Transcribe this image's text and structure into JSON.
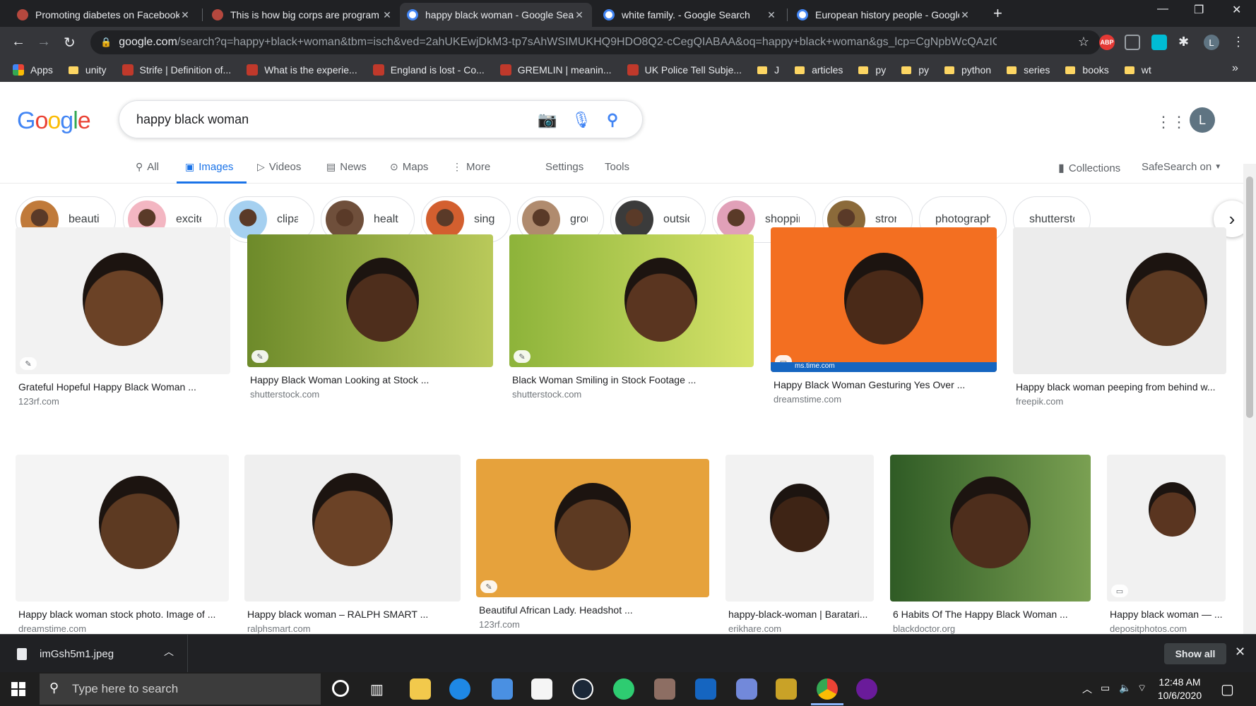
{
  "browser": {
    "tabs": [
      {
        "title": "Promoting diabetes on Facebook",
        "active": false
      },
      {
        "title": "This is how big corps are program",
        "active": false
      },
      {
        "title": "happy black woman - Google Sea",
        "active": true
      },
      {
        "title": "white family. - Google Search",
        "active": false
      },
      {
        "title": "European history people - Google",
        "active": false
      }
    ],
    "url_host": "google.com",
    "url_path": "/search?q=happy+black+woman&tbm=isch&ved=2ahUKEwjDkM3-tp7sAhWSIMUKHQ9HDO8Q2-cCegQIABAA&oq=happy+black+woman&gs_lcp=CgNpbWcQAzICCAAyA...",
    "profile_initial": "L",
    "abp_label": "ABP",
    "bookmarks": [
      {
        "label": "Apps",
        "kind": "apps"
      },
      {
        "label": "unity",
        "kind": "folder"
      },
      {
        "label": "Strife | Definition of...",
        "kind": "site"
      },
      {
        "label": "What is the experie...",
        "kind": "site"
      },
      {
        "label": "England is lost - Co...",
        "kind": "site"
      },
      {
        "label": "GREMLIN | meanin...",
        "kind": "site"
      },
      {
        "label": "UK Police Tell Subje...",
        "kind": "site"
      },
      {
        "label": "J",
        "kind": "folder"
      },
      {
        "label": "articles",
        "kind": "folder"
      },
      {
        "label": "py",
        "kind": "folder"
      },
      {
        "label": "py",
        "kind": "folder"
      },
      {
        "label": "python",
        "kind": "folder"
      },
      {
        "label": "series",
        "kind": "folder"
      },
      {
        "label": "books",
        "kind": "folder"
      },
      {
        "label": "wt",
        "kind": "folder"
      }
    ],
    "overflow": "»"
  },
  "google": {
    "logo": [
      "G",
      "o",
      "o",
      "g",
      "l",
      "e"
    ],
    "query": "happy black woman",
    "avatar": "L",
    "nav": {
      "all": "All",
      "images": "Images",
      "videos": "Videos",
      "news": "News",
      "maps": "Maps",
      "more": "More",
      "settings": "Settings",
      "tools": "Tools",
      "collections": "Collections",
      "safesearch": "SafeSearch on"
    },
    "chips": [
      "beautiful",
      "excited",
      "clipart",
      "healthy",
      "single",
      "group",
      "outside",
      "shopping",
      "strong",
      "photography",
      "shutterstc"
    ],
    "results_row1": [
      {
        "caption": "Grateful Hopeful Happy Black Woman ...",
        "source": "123rf.com",
        "tag": "✎"
      },
      {
        "caption": "Happy Black Woman Looking at Stock ...",
        "source": "shutterstock.com",
        "tag": "✎"
      },
      {
        "caption": "Black Woman Smiling in Stock Footage ...",
        "source": "shutterstock.com",
        "tag": "✎"
      },
      {
        "caption": "Happy Black Woman Gesturing Yes Over ...",
        "source": "dreamstime.com",
        "tag": "▭",
        "watermark": "ms.time.com"
      },
      {
        "caption": "Happy black woman peeping from behind w...",
        "source": "freepik.com",
        "tag": ""
      }
    ],
    "results_row2": [
      {
        "caption": "Happy black woman stock photo. Image of ...",
        "source": "dreamstime.com",
        "tag": ""
      },
      {
        "caption": "Happy black woman – RALPH SMART ...",
        "source": "ralphsmart.com",
        "tag": ""
      },
      {
        "caption": "Beautiful African Lady. Headshot ...",
        "source": "123rf.com",
        "tag": "✎"
      },
      {
        "caption": "happy-black-woman | Baratari...",
        "source": "erikhare.com",
        "tag": ""
      },
      {
        "caption": "6 Habits Of The Happy Black Woman ...",
        "source": "blackdoctor.org",
        "tag": ""
      },
      {
        "caption": "Happy black woman — ...",
        "source": "depositphotos.com",
        "tag": "▭"
      }
    ]
  },
  "downloads": {
    "file": "imGsh5m1.jpeg",
    "show_all": "Show all"
  },
  "taskbar": {
    "search_placeholder": "Type here to search",
    "time": "12:48 AM",
    "date": "10/6/2020"
  }
}
